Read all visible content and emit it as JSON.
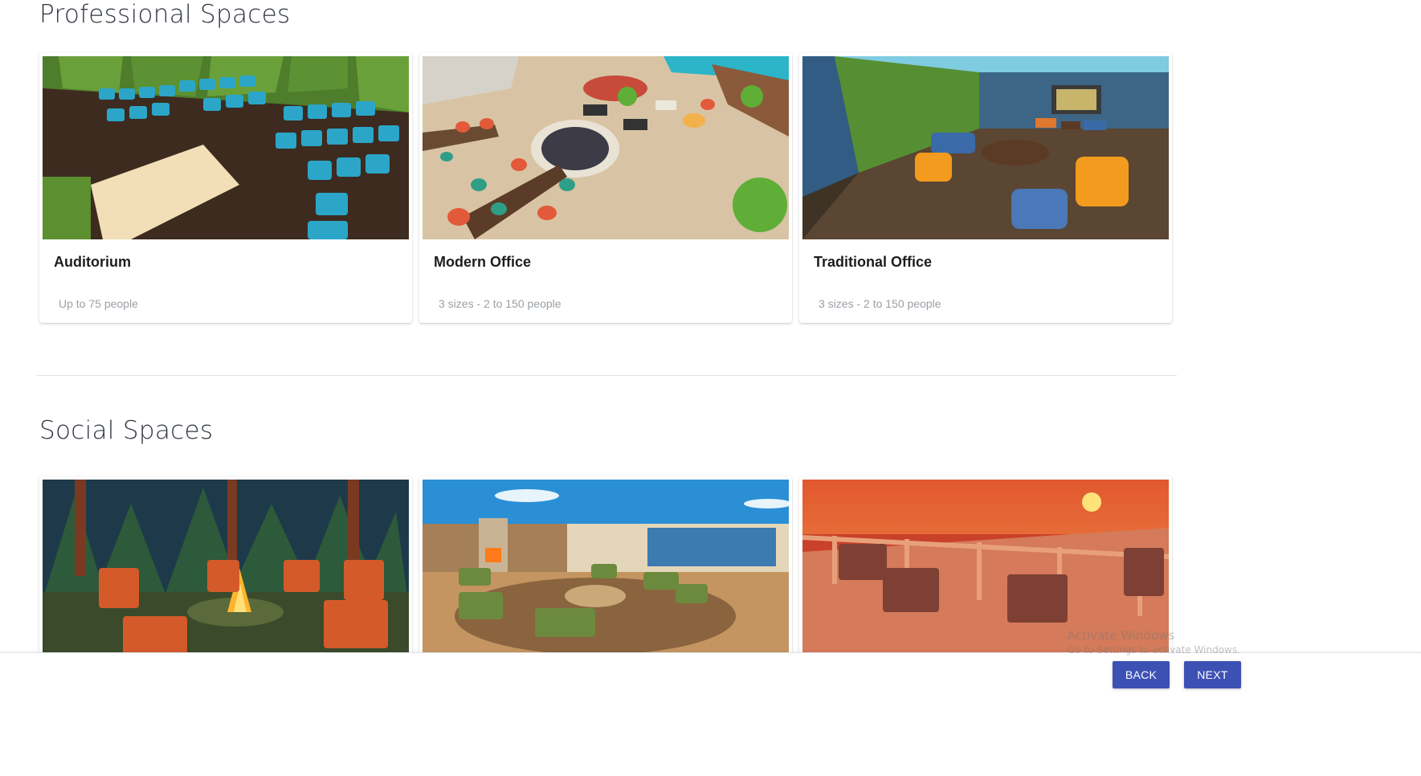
{
  "professional": {
    "title": "Professional Spaces",
    "cards": [
      {
        "title": "Auditorium",
        "subtitle": "Up to 75 people"
      },
      {
        "title": "Modern Office",
        "subtitle": "3 sizes - 2 to 150 people"
      },
      {
        "title": "Traditional Office",
        "subtitle": "3 sizes - 2 to 150 people"
      }
    ]
  },
  "social": {
    "title": "Social Spaces",
    "cards": [
      {
        "title": "",
        "subtitle": ""
      },
      {
        "title": "",
        "subtitle": ""
      },
      {
        "title": "",
        "subtitle": ""
      }
    ]
  },
  "footer": {
    "back_label": "BACK",
    "next_label": "NEXT"
  },
  "watermark": {
    "line1": "Activate Windows",
    "line2": "Go to Settings to activate Windows."
  },
  "colors": {
    "button": "#3d51b4",
    "title_text": "#2f3440",
    "subtitle_text": "#9aa0a6"
  }
}
